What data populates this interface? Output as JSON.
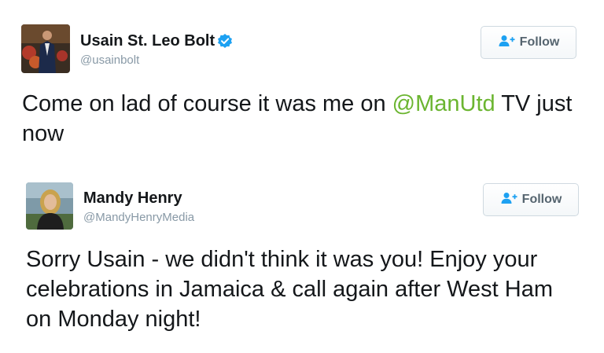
{
  "tweets": [
    {
      "author_name": "Usain St. Leo Bolt",
      "handle": "@usainbolt",
      "verified": true,
      "follow_label": "Follow",
      "text_before": "Come on lad of course it was me on ",
      "mention": "@ManUtd",
      "text_after": " TV just now"
    },
    {
      "author_name": "Mandy Henry",
      "handle": "@MandyHenryMedia",
      "verified": false,
      "follow_label": "Follow",
      "text": "Sorry Usain - we didn't think it was you! Enjoy your celebrations in Jamaica & call again after West Ham on Monday night!"
    }
  ],
  "colors": {
    "mention": "#6bb530",
    "verified": "#1da1f2",
    "follow_icon": "#1da1f2",
    "handle": "#8899a6"
  },
  "icons": {
    "verified": "verified-badge-icon",
    "follow": "add-user-icon"
  }
}
